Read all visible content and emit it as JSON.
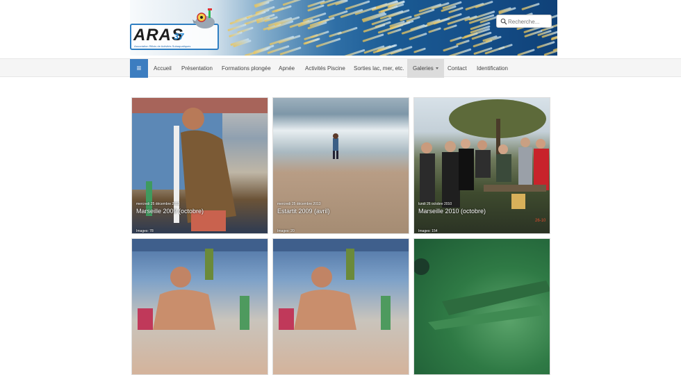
{
  "header": {
    "logo_text": "ARAS",
    "logo_number": "37",
    "logo_subtitle": "Association Rillois de Activités Subaquatiques",
    "search_placeholder": "Recherche..."
  },
  "nav": {
    "menu_icon": "hamburger-icon",
    "items": [
      {
        "label": "Accueil"
      },
      {
        "label": "Présentation"
      },
      {
        "label": "Formations plongée"
      },
      {
        "label": "Apnée"
      },
      {
        "label": "Activités Piscine"
      },
      {
        "label": "Sorties lac, mer, etc."
      },
      {
        "label": "Galeries",
        "active": true
      },
      {
        "label": "Contact"
      },
      {
        "label": "Identification"
      }
    ]
  },
  "gallery": [
    {
      "date": "mercredi 25 décembre 2013",
      "title": "Marseille 2009 (octobre)",
      "count": "Images: 78"
    },
    {
      "date": "mercredi 25 décembre 2013",
      "title": "Estartit 2009 (avril)",
      "count": "Images: 20"
    },
    {
      "date": "lundi 26 octobre 2010",
      "title": "Marseille 2010 (octobre)",
      "count": "Images: 154",
      "stamp": "26-10"
    },
    {
      "date": "",
      "title": "",
      "count": ""
    },
    {
      "date": "",
      "title": "",
      "count": ""
    },
    {
      "date": "",
      "title": "",
      "count": ""
    }
  ],
  "colors": {
    "nav_active_bg": "#dcdcdc",
    "menu_button_bg": "#3c7dc0",
    "banner_blue": "#16508a"
  }
}
